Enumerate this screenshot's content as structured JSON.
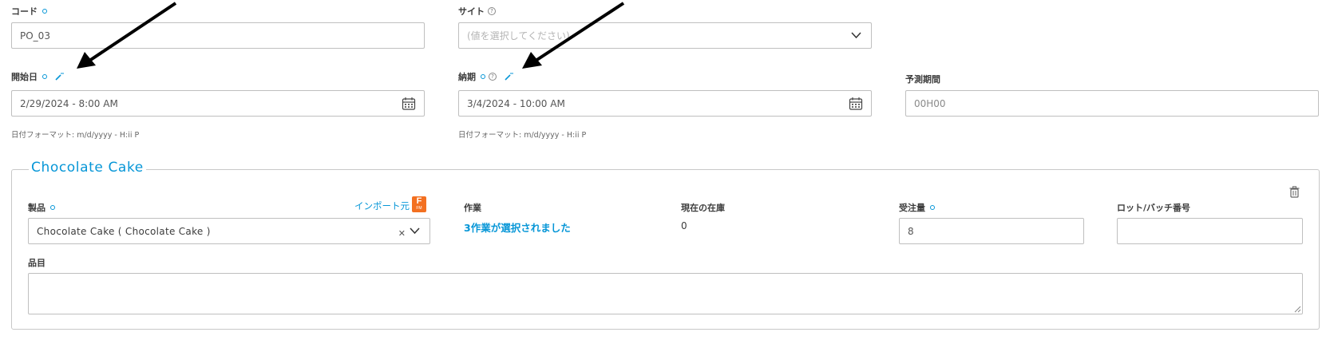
{
  "code": {
    "label": "コード",
    "value": "PO_03"
  },
  "site": {
    "label": "サイト",
    "placeholder": "(値を選択してください)"
  },
  "start_date": {
    "label": "開始日",
    "value": "2/29/2024 - 8:00 AM",
    "hint": "日付フォーマット: m/d/yyyy - H:ii P"
  },
  "due_date": {
    "label": "納期",
    "value": "3/4/2024 - 10:00 AM",
    "hint": "日付フォーマット: m/d/yyyy - H:ii P"
  },
  "forecast": {
    "label": "予測期間",
    "placeholder": "00H00"
  },
  "section": {
    "title": "Chocolate Cake",
    "product": {
      "label": "製品",
      "value": "Chocolate Cake ( Chocolate Cake )",
      "import_label": "インポート元",
      "import_badge": "F",
      "import_badge_sub": "FM"
    },
    "operations": {
      "label": "作業",
      "link": "3作業が選択されました"
    },
    "stock": {
      "label": "現在の在庫",
      "value": "0"
    },
    "quantity": {
      "label": "受注量",
      "value": "8"
    },
    "lot": {
      "label": "ロット/バッチ番号",
      "value": ""
    },
    "item": {
      "label": "品目",
      "value": ""
    }
  },
  "colors": {
    "accent": "#0696d7",
    "badge": "#f37021"
  },
  "icons": [
    "required-dot-icon",
    "help-icon",
    "magic-wand-icon",
    "calendar-icon",
    "chevron-down-icon",
    "clear-icon",
    "trash-icon",
    "resize-handle-icon"
  ]
}
